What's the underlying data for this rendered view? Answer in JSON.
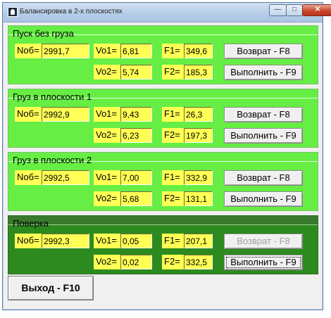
{
  "window": {
    "title": "Балансировка  в 2-х плоскостях",
    "min_label": "—",
    "max_label": "□",
    "close_label": "✕"
  },
  "groups": [
    {
      "title": "Пуск без груза",
      "nob_label": "Nоб=",
      "nob": "2991,7",
      "vo1_label": "Vo1=",
      "vo1": "6,81",
      "vo2_label": "Vo2=",
      "vo2": "5,74",
      "f1_label": "F1=",
      "f1": "349,6",
      "f2_label": "F2=",
      "f2": "185,3",
      "return_label": "Возврат - F8",
      "execute_label": "Выполнить - F9"
    },
    {
      "title": "Груз в плоскости 1",
      "nob_label": "Nоб=",
      "nob": "2992,9",
      "vo1_label": "Vo1=",
      "vo1": "9,43",
      "vo2_label": "Vo2=",
      "vo2": "6,23",
      "f1_label": "F1=",
      "f1": "26,3",
      "f2_label": "F2=",
      "f2": "197,3",
      "return_label": "Возврат - F8",
      "execute_label": "Выполнить - F9"
    },
    {
      "title": "Груз в плоскости 2",
      "nob_label": "Nоб=",
      "nob": "2992,5",
      "vo1_label": "Vo1=",
      "vo1": "7,00",
      "vo2_label": "Vo2=",
      "vo2": "5,68",
      "f1_label": "F1=",
      "f1": "332,9",
      "f2_label": "F2=",
      "f2": "131,1",
      "return_label": "Возврат - F8",
      "execute_label": "Выполнить - F9"
    },
    {
      "title": "Поверка",
      "nob_label": "Nоб=",
      "nob": "2992,3",
      "vo1_label": "Vo1=",
      "vo1": "0,05",
      "vo2_label": "Vo2=",
      "vo2": "0,02",
      "f1_label": "F1=",
      "f1": "207,1",
      "f2_label": "F2=",
      "f2": "332,5",
      "return_label": "Возврат - F8",
      "execute_label": "Выполнить - F9"
    }
  ],
  "exit_label": "Выход - F10",
  "colors": {
    "group_bg": "#66ee44",
    "group_bg_dark": "#2d8a1f",
    "field_bg": "#ffff55"
  }
}
